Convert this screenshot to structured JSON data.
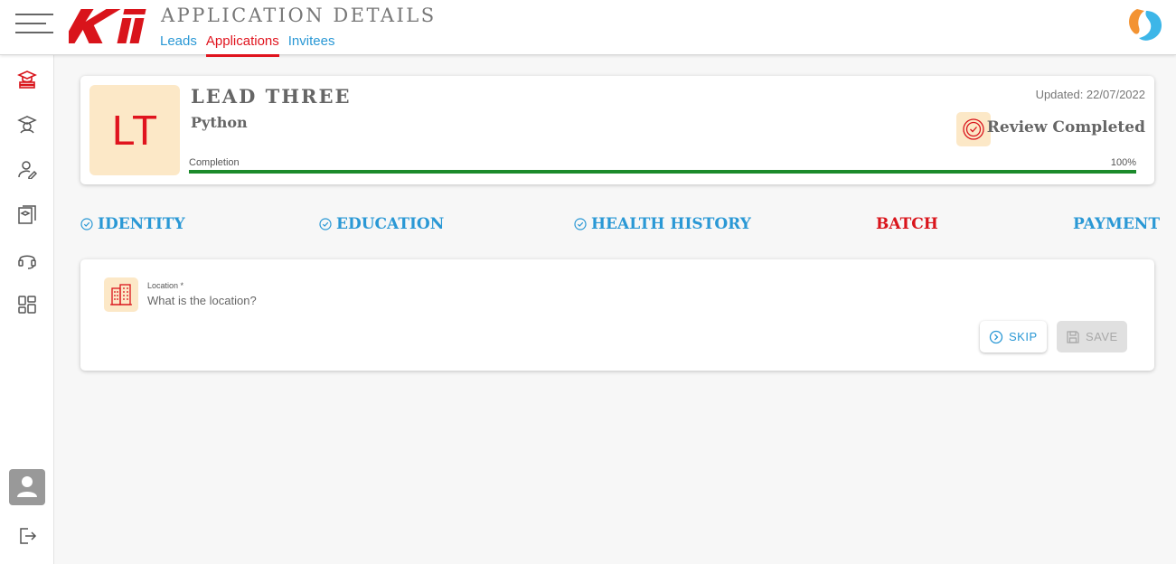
{
  "header": {
    "title": "APPLICATION DETAILS",
    "logo_text": "KII",
    "tabs": [
      {
        "label": "Leads",
        "active": false
      },
      {
        "label": "Applications",
        "active": true
      },
      {
        "label": "Invitees",
        "active": false
      }
    ]
  },
  "rail": {
    "items": [
      {
        "icon": "graduation-books-icon",
        "active": true
      },
      {
        "icon": "student-icon",
        "active": false
      },
      {
        "icon": "user-edit-icon",
        "active": false
      },
      {
        "icon": "courses-icon",
        "active": false
      },
      {
        "icon": "headset-icon",
        "active": false
      },
      {
        "icon": "dashboard-grid-icon",
        "active": false
      }
    ],
    "bottom": [
      "avatar-icon",
      "logout-icon"
    ]
  },
  "lead": {
    "initials": "LT",
    "name": "LEAD THREE",
    "course": "Python",
    "updated": "Updated: 22/07/2022",
    "status": "Review Completed",
    "completion_label": "Completion",
    "completion_pct_text": "100%",
    "completion_value": 1.0
  },
  "steps": [
    {
      "label": "IDENTITY",
      "done": true,
      "active": false
    },
    {
      "label": "EDUCATION",
      "done": true,
      "active": false
    },
    {
      "label": "HEALTH HISTORY",
      "done": true,
      "active": false
    },
    {
      "label": "BATCH",
      "done": false,
      "active": true
    },
    {
      "label": "PAYMENT",
      "done": false,
      "active": false
    }
  ],
  "form": {
    "location_label": "Location *",
    "location_placeholder": "What is the location?",
    "location_value": "",
    "skip_label": "SKIP",
    "save_label": "SAVE"
  },
  "colors": {
    "accent_red": "#e0141e",
    "link_blue": "#2a98d5",
    "progress_green": "#1b8a2b",
    "icon_bg": "#fce8c7"
  }
}
